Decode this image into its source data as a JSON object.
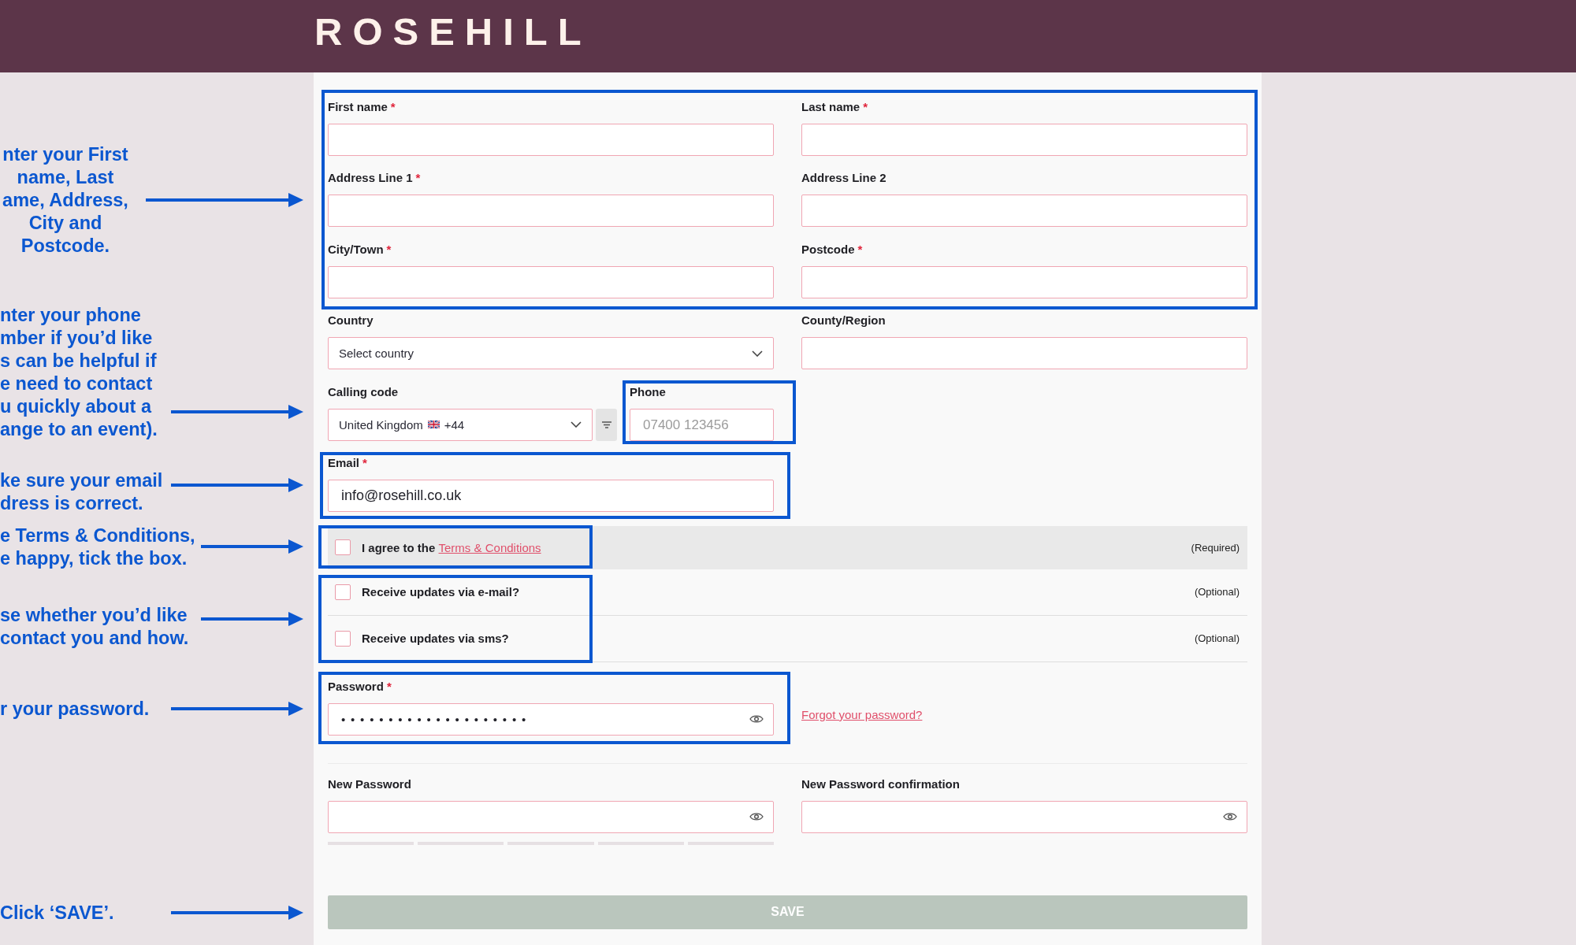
{
  "header": {
    "logo": "ROSEHILL"
  },
  "annotations": [
    {
      "lines": [
        "nter your First",
        "name, Last",
        "ame, Address,",
        "City and",
        "Postcode."
      ]
    },
    {
      "lines": [
        "nter your phone",
        "mber if you’d like",
        "s can be helpful if",
        "e need to contact",
        "u quickly about a",
        "ange to an event)."
      ]
    },
    {
      "lines": [
        "ke sure your email",
        "dress is correct."
      ]
    },
    {
      "lines": [
        "e Terms & Conditions,",
        "e happy, tick the box."
      ]
    },
    {
      "lines": [
        "se whether you’d like",
        "contact you and how."
      ]
    },
    {
      "lines": [
        "r your password."
      ]
    },
    {
      "lines": [
        "Click ‘SAVE’."
      ]
    }
  ],
  "form": {
    "name_address_fields": [
      {
        "label": "First name",
        "required_mark": "*"
      },
      {
        "label": "Last name",
        "required_mark": "*"
      },
      {
        "label": "Address Line 1",
        "required_mark": "*"
      },
      {
        "label": "Address Line 2"
      },
      {
        "label": "City/Town",
        "required_mark": "*"
      },
      {
        "label": "Postcode",
        "required_mark": "*"
      }
    ],
    "country": {
      "label": "Country",
      "value": "Select country"
    },
    "county_region": {
      "label": "County/Region"
    },
    "calling_code": {
      "label": "Calling code",
      "value": "United Kingdom",
      "dial_code": "+44"
    },
    "phone": {
      "label": "Phone",
      "placeholder": "07400 123456"
    },
    "email": {
      "label": "Email",
      "required_mark": "*",
      "value": "info@rosehill.co.uk"
    },
    "consents": [
      {
        "kind": "banded",
        "text": "I agree to the",
        "link": "Terms & Conditions",
        "checked": false,
        "note": "(Required)"
      },
      {
        "kind": "plain",
        "text": "Receive updates via e-mail?",
        "checked": false,
        "note": "(Optional)"
      },
      {
        "kind": "plain",
        "text": "Receive updates via sms?",
        "checked": false,
        "note": "(Optional)"
      }
    ],
    "password": {
      "label": "Password",
      "required_mark": "*",
      "value": "••••••••••••••••••••",
      "forgot_link": "Forgot your password?"
    },
    "new_password": {
      "label": "New Password",
      "strength": {
        "level": 0
      }
    },
    "new_password_confirmation": {
      "label": "New Password confirmation"
    },
    "save_button": {
      "label": "SAVE",
      "disabled": true
    }
  }
}
